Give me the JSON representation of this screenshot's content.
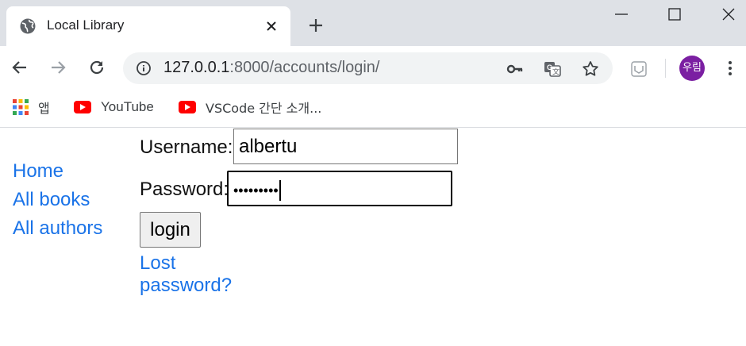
{
  "tab": {
    "title": "Local Library"
  },
  "omnibox": {
    "url_host": "127.0.0.1",
    "url_path": ":8000/accounts/login/"
  },
  "profile": {
    "initials": "우림",
    "color": "#7b1fa2"
  },
  "bookmarks": [
    {
      "label": "앱",
      "icon": "apps-grid-icon"
    },
    {
      "label": "YouTube",
      "icon": "youtube-icon"
    },
    {
      "label": "VSCode 간단 소개...",
      "icon": "youtube-icon"
    }
  ],
  "sidebar": {
    "links": [
      "Home",
      "All books",
      "All authors"
    ]
  },
  "form": {
    "username_label": "Username:",
    "username_value": "albertu",
    "password_label": "Password:",
    "password_value": "•••••••••",
    "submit_label": "login",
    "lost_password": "Lost password?"
  },
  "colors": {
    "link": "#1a73e8",
    "tabstrip": "#dee1e6",
    "omnibox": "#f1f3f4"
  }
}
